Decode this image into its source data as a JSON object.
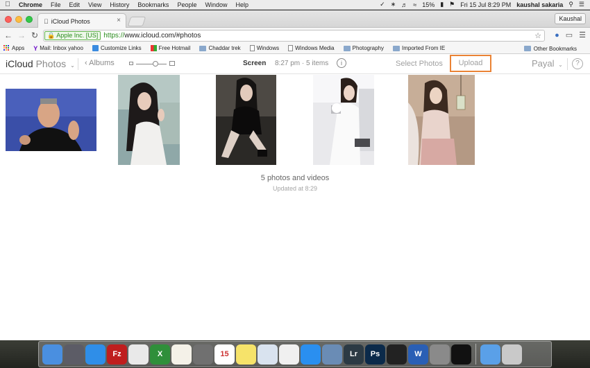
{
  "menubar": {
    "app_name": "Chrome",
    "items": [
      "File",
      "Edit",
      "View",
      "History",
      "Bookmarks",
      "People",
      "Window",
      "Help"
    ],
    "battery": "15%",
    "datetime": "Fri 15 Jul  8:29 PM",
    "user": "kaushal sakaria"
  },
  "browser": {
    "tab_title": "iCloud Photos",
    "profile_name": "Kaushal",
    "ev_label": "Apple Inc. [US]",
    "url_scheme": "https://",
    "url_rest": "www.icloud.com/#photos"
  },
  "bookmarks": {
    "items": [
      {
        "label": "Apps",
        "icon": "apps-grid-icon"
      },
      {
        "label": "Mail: Inbox yahoo",
        "icon": "yahoo-icon"
      },
      {
        "label": "Customize Links",
        "icon": "customize-links-icon"
      },
      {
        "label": "Free Hotmail",
        "icon": "hotmail-icon"
      },
      {
        "label": "Chaddar trek",
        "icon": "folder-icon"
      },
      {
        "label": "Windows",
        "icon": "page-icon"
      },
      {
        "label": "Windows Media",
        "icon": "page-icon"
      },
      {
        "label": "Photography",
        "icon": "folder-icon"
      },
      {
        "label": "Imported From IE",
        "icon": "folder-icon"
      }
    ],
    "overflow": "»",
    "other": "Other Bookmarks"
  },
  "icloud": {
    "brand": "iCloud",
    "app": "Photos",
    "albums_label": "Albums",
    "view_title": "Screen",
    "view_info": "8:27 pm · 5 items",
    "select_label": "Select Photos",
    "upload_label": "Upload",
    "user_name": "Payal",
    "summary": "5 photos and videos",
    "updated": "Updated at 8:29"
  },
  "colors": {
    "upload_highlight": "#ea8335",
    "ev_green": "#2a8c1d"
  },
  "dock": {
    "apps": [
      {
        "name": "finder-icon",
        "color": "#4a8fe0",
        "label": ""
      },
      {
        "name": "launchpad-icon",
        "color": "#5c5c66",
        "label": ""
      },
      {
        "name": "safari-icon",
        "color": "#2f8ee8",
        "label": ""
      },
      {
        "name": "filezilla-icon",
        "color": "#bf1e1e",
        "label": "Fz"
      },
      {
        "name": "chrome-icon",
        "color": "#e9e9e9",
        "label": ""
      },
      {
        "name": "excel-icon",
        "color": "#2f8f3a",
        "label": "X"
      },
      {
        "name": "textedit-icon",
        "color": "#f4f1e8",
        "label": ""
      },
      {
        "name": "calculator-icon",
        "color": "#707070",
        "label": ""
      },
      {
        "name": "calendar-icon",
        "color": "#ffffff",
        "label": "15"
      },
      {
        "name": "notes-icon",
        "color": "#f6e36a",
        "label": ""
      },
      {
        "name": "preview-icon",
        "color": "#d9e3ef",
        "label": ""
      },
      {
        "name": "photos-icon",
        "color": "#f0f0f0",
        "label": ""
      },
      {
        "name": "app-store-icon",
        "color": "#2a8ff0",
        "label": ""
      },
      {
        "name": "image-capture-icon",
        "color": "#6a8cb5",
        "label": ""
      },
      {
        "name": "lightroom-icon",
        "color": "#2c3a44",
        "label": "Lr"
      },
      {
        "name": "photoshop-icon",
        "color": "#0b2a4a",
        "label": "Ps"
      },
      {
        "name": "terminal-icon",
        "color": "#222222",
        "label": ""
      },
      {
        "name": "word-icon",
        "color": "#2a5fb5",
        "label": "W"
      },
      {
        "name": "system-preferences-icon",
        "color": "#8a8a8a",
        "label": ""
      },
      {
        "name": "gopro-icon",
        "color": "#111111",
        "label": ""
      },
      {
        "name": "folder-icon",
        "color": "#5aa0e8",
        "label": ""
      },
      {
        "name": "trash-icon",
        "color": "#c9c9c9",
        "label": ""
      }
    ]
  }
}
